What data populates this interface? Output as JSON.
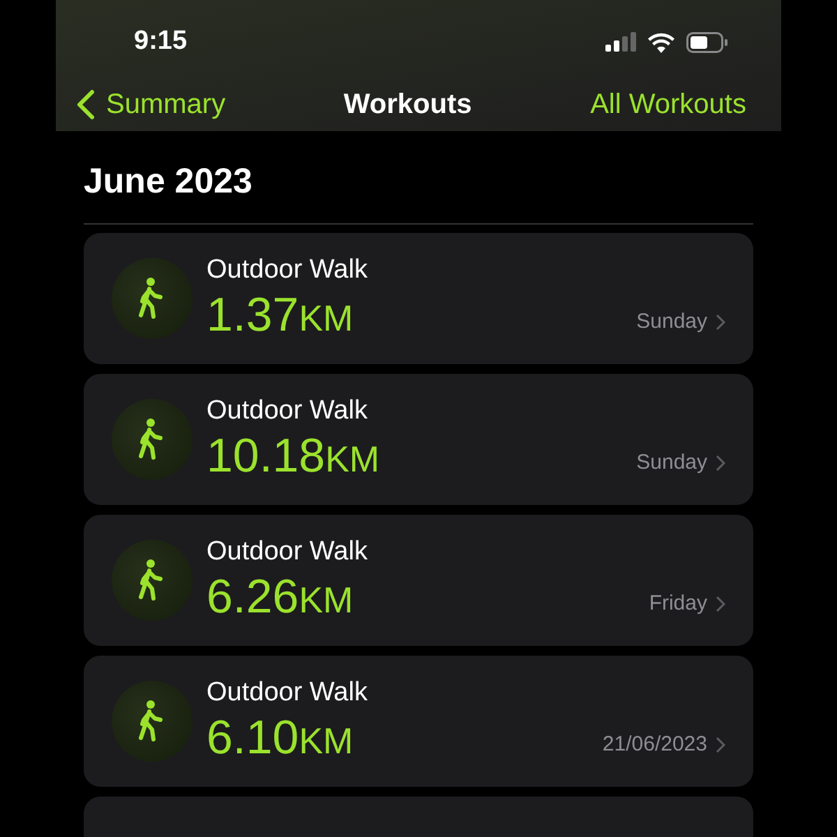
{
  "status_bar": {
    "time": "9:15"
  },
  "nav": {
    "back": "Summary",
    "title": "Workouts",
    "action": "All Workouts"
  },
  "section": {
    "title": "June 2023"
  },
  "workouts": [
    {
      "name": "Outdoor Walk",
      "distance": "1.37",
      "unit": "KM",
      "date": "Sunday"
    },
    {
      "name": "Outdoor Walk",
      "distance": "10.18",
      "unit": "KM",
      "date": "Sunday"
    },
    {
      "name": "Outdoor Walk",
      "distance": "6.26",
      "unit": "KM",
      "date": "Friday"
    },
    {
      "name": "Outdoor Walk",
      "distance": "6.10",
      "unit": "KM",
      "date": "21/06/2023"
    }
  ]
}
